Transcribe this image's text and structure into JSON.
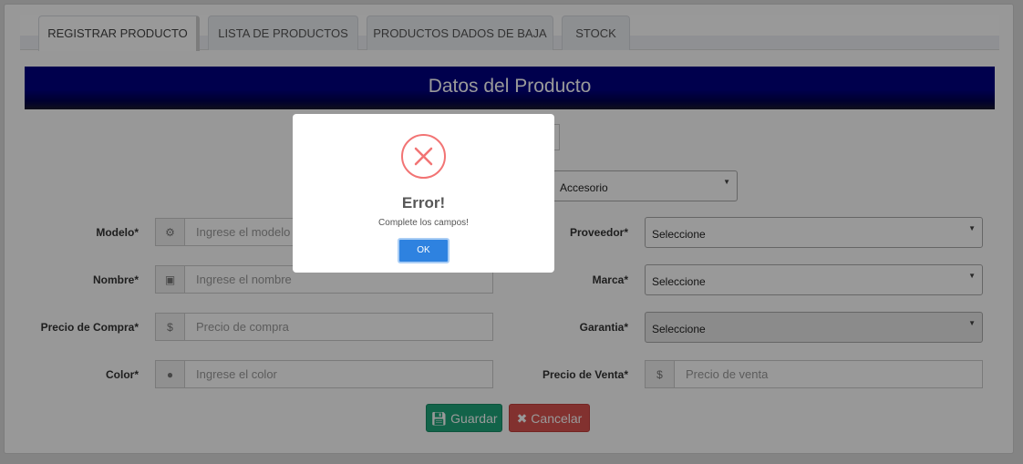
{
  "tabs": [
    {
      "label": "REGISTRAR PRODUCTO",
      "active": true
    },
    {
      "label": "LISTA DE PRODUCTOS",
      "active": false
    },
    {
      "label": "PRODUCTOS DADOS DE BAJA",
      "active": false
    },
    {
      "label": "STOCK",
      "active": false
    }
  ],
  "form": {
    "title": "Datos del Producto",
    "categoria_value": "Accesorio",
    "modelo": {
      "label": "Modelo*",
      "placeholder": "Ingrese el modelo",
      "icon": "gear-icon"
    },
    "nombre": {
      "label": "Nombre*",
      "placeholder": "Ingrese el nombre",
      "icon": "play-square-icon"
    },
    "precio_compra": {
      "label": "Precio de Compra*",
      "placeholder": "Precio de compra",
      "icon": "dollar-icon"
    },
    "color": {
      "label": "Color*",
      "placeholder": "Ingrese el color",
      "icon": "droplet-icon"
    },
    "proveedor": {
      "label": "Proveedor*",
      "value": "Seleccione"
    },
    "marca": {
      "label": "Marca*",
      "value": "Seleccione"
    },
    "garantia": {
      "label": "Garantia*",
      "value": "Seleccione"
    },
    "precio_venta": {
      "label": "Precio de Venta*",
      "placeholder": "Precio de venta",
      "icon": "dollar-icon"
    },
    "save_label": "Guardar",
    "cancel_label": "Cancelar"
  },
  "modal": {
    "title": "Error!",
    "message": "Complete los campos!",
    "ok_label": "OK",
    "icon": "error-x-icon",
    "accent": "#f27474",
    "button_color": "#2e82e0"
  },
  "colors": {
    "header": "#000080",
    "save": "#1fa67a",
    "cancel": "#d9534f"
  }
}
